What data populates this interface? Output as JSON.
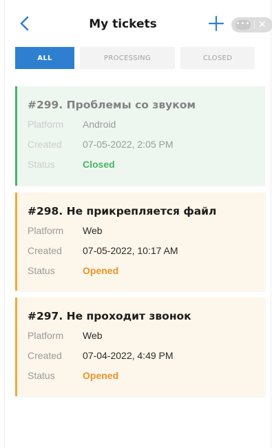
{
  "header": {
    "title": "My tickets",
    "accent_color": "#2f7fd1"
  },
  "tabs": [
    {
      "label": "ALL",
      "active": true
    },
    {
      "label": "PROCESSING",
      "active": false
    },
    {
      "label": "CLOSED",
      "active": false
    }
  ],
  "labels": {
    "platform": "Platform",
    "created": "Created",
    "status": "Status"
  },
  "tickets": [
    {
      "title": "#299. Проблемы со звуком",
      "platform": "Android",
      "created": "07-05-2022, 2:05 PM",
      "status": "Closed",
      "status_color": "#2ba84a"
    },
    {
      "title": "#298. Не прикрепляется файл",
      "platform": "Web",
      "created": "07-05-2022, 10:17 AM",
      "status": "Opened",
      "status_color": "#e8932b"
    },
    {
      "title": "#297. Не проходит звонок",
      "platform": "Web",
      "created": "07-04-2022, 4:49 PM",
      "status": "Opened",
      "status_color": "#e8932b"
    }
  ]
}
